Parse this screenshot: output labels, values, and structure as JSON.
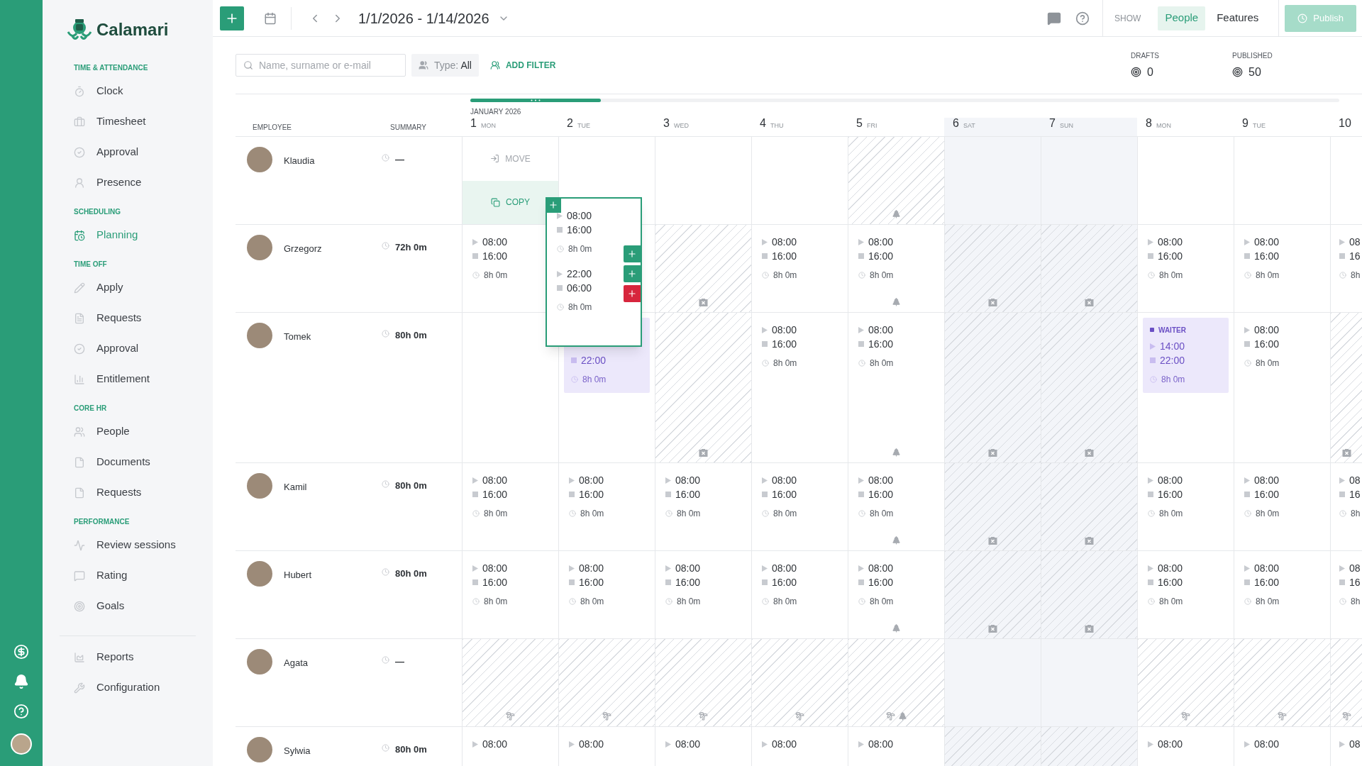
{
  "sidebar": {
    "logo": "Calamari",
    "sections": [
      {
        "title": "TIME & ATTENDANCE",
        "items": [
          {
            "label": "Clock",
            "selected": false
          },
          {
            "label": "Timesheet",
            "selected": false
          },
          {
            "label": "Approval",
            "selected": false
          },
          {
            "label": "Presence",
            "selected": false
          }
        ]
      },
      {
        "title": "SCHEDULING",
        "items": [
          {
            "label": "Planning",
            "selected": true
          }
        ]
      },
      {
        "title": "TIME OFF",
        "items": [
          {
            "label": "Apply",
            "selected": false
          },
          {
            "label": "Requests",
            "selected": false
          },
          {
            "label": "Approval",
            "selected": false
          },
          {
            "label": "Entitlement",
            "selected": false
          }
        ]
      },
      {
        "title": "CORE HR",
        "items": [
          {
            "label": "People",
            "selected": false
          },
          {
            "label": "Documents",
            "selected": false
          },
          {
            "label": "Requests",
            "selected": false
          }
        ]
      },
      {
        "title": "PERFORMANCE",
        "items": [
          {
            "label": "Review sessions",
            "selected": false
          },
          {
            "label": "Rating",
            "selected": false
          },
          {
            "label": "Goals",
            "selected": false
          }
        ]
      }
    ],
    "footer_items": [
      {
        "label": "Reports",
        "selected": false
      },
      {
        "label": "Configuration",
        "selected": false
      }
    ]
  },
  "toolbar": {
    "date_range": "1/1/2026 - 1/14/2026",
    "show_label": "SHOW",
    "views": [
      {
        "label": "People",
        "selected": true
      },
      {
        "label": "Features",
        "selected": false
      }
    ],
    "publish": {
      "label": "Publish",
      "disabled": true
    }
  },
  "filters": {
    "search_placeholder": "Name, surname or e-mail",
    "type_label": "Type:",
    "type_value": "All",
    "add_filter": "ADD FILTER"
  },
  "stats": [
    {
      "label": "DRAFTS",
      "value": "0"
    },
    {
      "label": "PUBLISHED",
      "value": "50"
    }
  ],
  "timeline": {
    "level": 0.15
  },
  "grid": {
    "month": "JANUARY 2026",
    "employee_header": "EMPLOYEE",
    "summary_header": "SUMMARY",
    "days": [
      {
        "number": "1",
        "weekday": "MON",
        "weekend": false
      },
      {
        "number": "2",
        "weekday": "TUE",
        "weekend": false
      },
      {
        "number": "3",
        "weekday": "WED",
        "weekend": false
      },
      {
        "number": "4",
        "weekday": "THU",
        "weekend": false
      },
      {
        "number": "5",
        "weekday": "FRI",
        "weekend": false
      },
      {
        "number": "6",
        "weekday": "SAT",
        "weekend": true
      },
      {
        "number": "7",
        "weekday": "SUN",
        "weekend": true
      },
      {
        "number": "8",
        "weekday": "MON",
        "weekend": false
      },
      {
        "number": "9",
        "weekday": "TUE",
        "weekend": false
      },
      {
        "number": "10",
        "weekend": false
      }
    ],
    "rows": [
      {
        "name": "Klaudia",
        "summary": "—",
        "cells": [
          {
            "kind": "actions",
            "move": "MOVE",
            "copy": "COPY",
            "hatched": false
          },
          {
            "kind": "empty",
            "hatched": false
          },
          {
            "kind": "empty",
            "hatched": false
          },
          {
            "kind": "empty",
            "hatched": false
          },
          {
            "kind": "empty",
            "hatched": true,
            "markers": [
              {
                "kind": "holiday"
              }
            ]
          },
          {
            "kind": "empty",
            "hatched": false
          },
          {
            "kind": "empty",
            "hatched": false
          },
          {
            "kind": "empty",
            "hatched": false
          },
          {
            "kind": "empty",
            "hatched": false
          },
          {
            "kind": "empty",
            "hatched": false
          }
        ]
      },
      {
        "name": "Grzegorz",
        "summary": "72h 0m",
        "cells": [
          {
            "kind": "shift",
            "start": "08:00",
            "end": "16:00",
            "duration": "8h 0m",
            "hatched": false
          },
          {
            "kind": "empty",
            "hatched": false
          },
          {
            "kind": "empty",
            "hatched": true,
            "markers": [
              {
                "kind": "day_off"
              }
            ]
          },
          {
            "kind": "shift",
            "start": "08:00",
            "end": "16:00",
            "duration": "8h 0m",
            "hatched": false
          },
          {
            "kind": "shift",
            "start": "08:00",
            "end": "16:00",
            "duration": "8h 0m",
            "hatched": false,
            "markers": [
              {
                "kind": "holiday"
              }
            ]
          },
          {
            "kind": "empty",
            "hatched": true,
            "markers": [
              {
                "kind": "day_off"
              }
            ]
          },
          {
            "kind": "empty",
            "hatched": true,
            "markers": [
              {
                "kind": "day_off"
              }
            ]
          },
          {
            "kind": "shift",
            "start": "08:00",
            "end": "16:00",
            "duration": "8h 0m",
            "hatched": false
          },
          {
            "kind": "shift",
            "start": "08:00",
            "end": "16:00",
            "duration": "8h 0m",
            "hatched": false
          },
          {
            "kind": "shift",
            "start": "08",
            "end": "16",
            "duration": "8h",
            "hatched": false
          }
        ]
      },
      {
        "name": "Tomek",
        "summary": "80h 0m",
        "cells": [
          {
            "kind": "empty",
            "hatched": false
          },
          {
            "kind": "role_shift",
            "end": "22:00",
            "duration": "8h 0m",
            "hatched": false
          },
          {
            "kind": "empty",
            "hatched": true,
            "markers": [
              {
                "kind": "day_off"
              }
            ]
          },
          {
            "kind": "shift",
            "start": "08:00",
            "end": "16:00",
            "duration": "8h 0m",
            "hatched": false
          },
          {
            "kind": "shift",
            "start": "08:00",
            "end": "16:00",
            "duration": "8h 0m",
            "hatched": false,
            "markers": [
              {
                "kind": "holiday"
              }
            ]
          },
          {
            "kind": "empty",
            "hatched": true,
            "markers": [
              {
                "kind": "day_off"
              }
            ]
          },
          {
            "kind": "empty",
            "hatched": true,
            "markers": [
              {
                "kind": "day_off"
              }
            ]
          },
          {
            "kind": "role_shift",
            "role": "WAITER",
            "start": "14:00",
            "end": "22:00",
            "duration": "8h 0m",
            "hatched": false
          },
          {
            "kind": "shift",
            "start": "08:00",
            "end": "16:00",
            "duration": "8h 0m",
            "hatched": false
          },
          {
            "kind": "empty",
            "hatched": true,
            "markers": [
              {
                "kind": "day_off"
              }
            ]
          }
        ]
      },
      {
        "name": "Kamil",
        "summary": "80h 0m",
        "cells": [
          {
            "kind": "shift",
            "start": "08:00",
            "end": "16:00",
            "duration": "8h 0m",
            "hatched": false
          },
          {
            "kind": "shift",
            "start": "08:00",
            "end": "16:00",
            "duration": "8h 0m",
            "hatched": false
          },
          {
            "kind": "shift",
            "start": "08:00",
            "end": "16:00",
            "duration": "8h 0m",
            "hatched": false
          },
          {
            "kind": "shift",
            "start": "08:00",
            "end": "16:00",
            "duration": "8h 0m",
            "hatched": false
          },
          {
            "kind": "shift",
            "start": "08:00",
            "end": "16:00",
            "duration": "8h 0m",
            "hatched": false,
            "markers": [
              {
                "kind": "holiday"
              }
            ]
          },
          {
            "kind": "empty",
            "hatched": true,
            "markers": [
              {
                "kind": "day_off"
              }
            ]
          },
          {
            "kind": "empty",
            "hatched": true,
            "markers": [
              {
                "kind": "day_off"
              }
            ]
          },
          {
            "kind": "shift",
            "start": "08:00",
            "end": "16:00",
            "duration": "8h 0m",
            "hatched": false
          },
          {
            "kind": "shift",
            "start": "08:00",
            "end": "16:00",
            "duration": "8h 0m",
            "hatched": false
          },
          {
            "kind": "shift",
            "start": "08",
            "end": "16",
            "duration": "8h",
            "hatched": false
          }
        ]
      },
      {
        "name": "Hubert",
        "summary": "80h 0m",
        "cells": [
          {
            "kind": "shift",
            "start": "08:00",
            "end": "16:00",
            "duration": "8h 0m",
            "hatched": false
          },
          {
            "kind": "shift",
            "start": "08:00",
            "end": "16:00",
            "duration": "8h 0m",
            "hatched": false
          },
          {
            "kind": "shift",
            "start": "08:00",
            "end": "16:00",
            "duration": "8h 0m",
            "hatched": false
          },
          {
            "kind": "shift",
            "start": "08:00",
            "end": "16:00",
            "duration": "8h 0m",
            "hatched": false
          },
          {
            "kind": "shift",
            "start": "08:00",
            "end": "16:00",
            "duration": "8h 0m",
            "hatched": false,
            "markers": [
              {
                "kind": "holiday"
              }
            ]
          },
          {
            "kind": "empty",
            "hatched": true,
            "markers": [
              {
                "kind": "day_off"
              }
            ]
          },
          {
            "kind": "empty",
            "hatched": true,
            "markers": [
              {
                "kind": "day_off"
              }
            ]
          },
          {
            "kind": "shift",
            "start": "08:00",
            "end": "16:00",
            "duration": "8h 0m",
            "hatched": false
          },
          {
            "kind": "shift",
            "start": "08:00",
            "end": "16:00",
            "duration": "8h 0m",
            "hatched": false
          },
          {
            "kind": "shift",
            "start": "08",
            "end": "16",
            "duration": "8h",
            "hatched": false
          }
        ]
      },
      {
        "name": "Agata",
        "summary": "—",
        "cells": [
          {
            "kind": "empty",
            "hatched": true,
            "markers": [
              {
                "kind": "vacation"
              }
            ]
          },
          {
            "kind": "empty",
            "hatched": true,
            "markers": [
              {
                "kind": "vacation"
              }
            ]
          },
          {
            "kind": "empty",
            "hatched": true,
            "markers": [
              {
                "kind": "vacation"
              }
            ]
          },
          {
            "kind": "empty",
            "hatched": true,
            "markers": [
              {
                "kind": "vacation"
              }
            ]
          },
          {
            "kind": "empty",
            "hatched": true,
            "markers": [
              {
                "kind": "vacation"
              },
              {
                "kind": "holiday"
              }
            ]
          },
          {
            "kind": "empty",
            "hatched": false
          },
          {
            "kind": "empty",
            "hatched": false
          },
          {
            "kind": "empty",
            "hatched": true,
            "markers": [
              {
                "kind": "vacation"
              }
            ]
          },
          {
            "kind": "empty",
            "hatched": true,
            "markers": [
              {
                "kind": "vacation"
              }
            ]
          },
          {
            "kind": "empty",
            "hatched": true,
            "markers": [
              {
                "kind": "vacation"
              }
            ]
          }
        ]
      },
      {
        "name": "Sylwia",
        "summary": "80h 0m",
        "cells": [
          {
            "kind": "shift",
            "start": "08:00",
            "hatched": false
          },
          {
            "kind": "shift",
            "start": "08:00",
            "hatched": false
          },
          {
            "kind": "shift",
            "start": "08:00",
            "hatched": false
          },
          {
            "kind": "shift",
            "start": "08:00",
            "hatched": false
          },
          {
            "kind": "shift",
            "start": "08:00",
            "hatched": false
          },
          {
            "kind": "empty",
            "hatched": true
          },
          {
            "kind": "empty",
            "hatched": true
          },
          {
            "kind": "shift",
            "start": "08:00",
            "hatched": false
          },
          {
            "kind": "shift",
            "start": "08:00",
            "hatched": false
          },
          {
            "kind": "shift",
            "start": "08",
            "hatched": false
          }
        ]
      }
    ]
  },
  "popup": {
    "shifts": [
      {
        "start": "08:00",
        "end": "16:00",
        "duration": "8h 0m"
      },
      {
        "start": "22:00",
        "end": "06:00",
        "duration": "8h 0m"
      }
    ],
    "buttons": [
      {
        "color": "#2a9d78"
      },
      {
        "color": "#2a9d78"
      },
      {
        "color": "#d7263d"
      }
    ]
  }
}
